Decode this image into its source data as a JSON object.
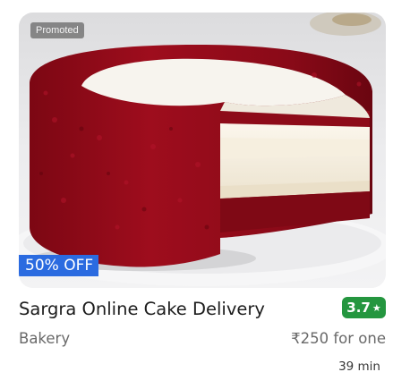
{
  "restaurant": {
    "promoted_label": "Promoted",
    "offer_label": "50% OFF",
    "name": "Sargra Online Cake Delivery",
    "rating": "3.7",
    "rating_icon": "star-icon",
    "cuisine": "Bakery",
    "price": "₹250 for one",
    "delivery_time": "39 min"
  },
  "colors": {
    "offer_badge": "#2b6be0",
    "rating_badge": "#24963f",
    "secondary_text": "#696969"
  }
}
